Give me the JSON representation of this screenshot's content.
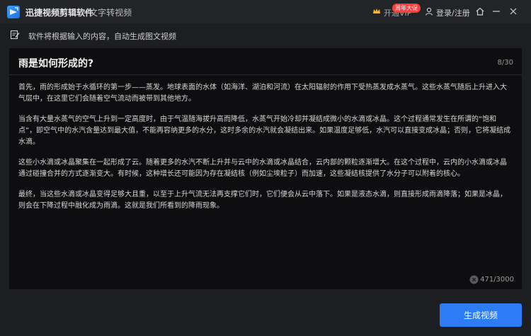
{
  "titlebar": {
    "app_name": "迅捷视频剪辑软件",
    "subtitle": "- 文字转视频",
    "vip_label": "开通VIP",
    "vip_badge": "周年大促",
    "login_label": "登录/注册"
  },
  "hint": {
    "text": "软件将根据输入的内容，自动生成图文视频"
  },
  "editor": {
    "title": "雨是如何形成的?",
    "title_count": "8/30",
    "paragraphs": [
      "首先，雨的形成始于水循环的第一步——蒸发。地球表面的水体（如海洋、湖泊和河流）在太阳辐射的作用下受热蒸发成水蒸气。这些水蒸气随后上升进入大气层中，在这里它们会随着空气流动而被带到其他地方。",
      "当含有大量水蒸气的空气上升到一定高度时，由于气温随海拔升高而降低，水蒸气开始冷却并凝结成微小的水滴或冰晶。这个过程通常发生在所谓的“饱和点”，即空气中的水汽含量达到最大值，不能再容纳更多的水分，这时多余的水汽就会凝结出来。如果温度足够低，水汽可以直接变成冰晶；否则，它将凝结成水滴。",
      "这些小水滴或冰晶聚集在一起形成了云。随着更多的水汽不断上升并与云中的水滴或冰晶结合，云内部的颗粒逐渐增大。在这个过程中，云内的小水滴或冰晶通过碰撞合并的方式逐渐变大。有时候，这种增长还可能因为存在凝结核（例如尘埃粒子）而加速，这些凝结核提供了水分子可以附着的核心。",
      "最终，当这些水滴或冰晶变得足够大且重，以至于上升气流无法再支撑它们时，它们便会从云中落下。如果是液态水滴，则直接形成雨滴降落；如果是冰晶，则会在下降过程中融化成为雨滴。这就是我们所看到的降雨现象。"
    ],
    "body_count": "471/3000"
  },
  "actions": {
    "generate_label": "生成视频"
  },
  "colors": {
    "accent": "#2d7cf6",
    "badge": "#ff3b3b",
    "background": "#1d1e22",
    "editor_bg": "#0e0e10"
  }
}
